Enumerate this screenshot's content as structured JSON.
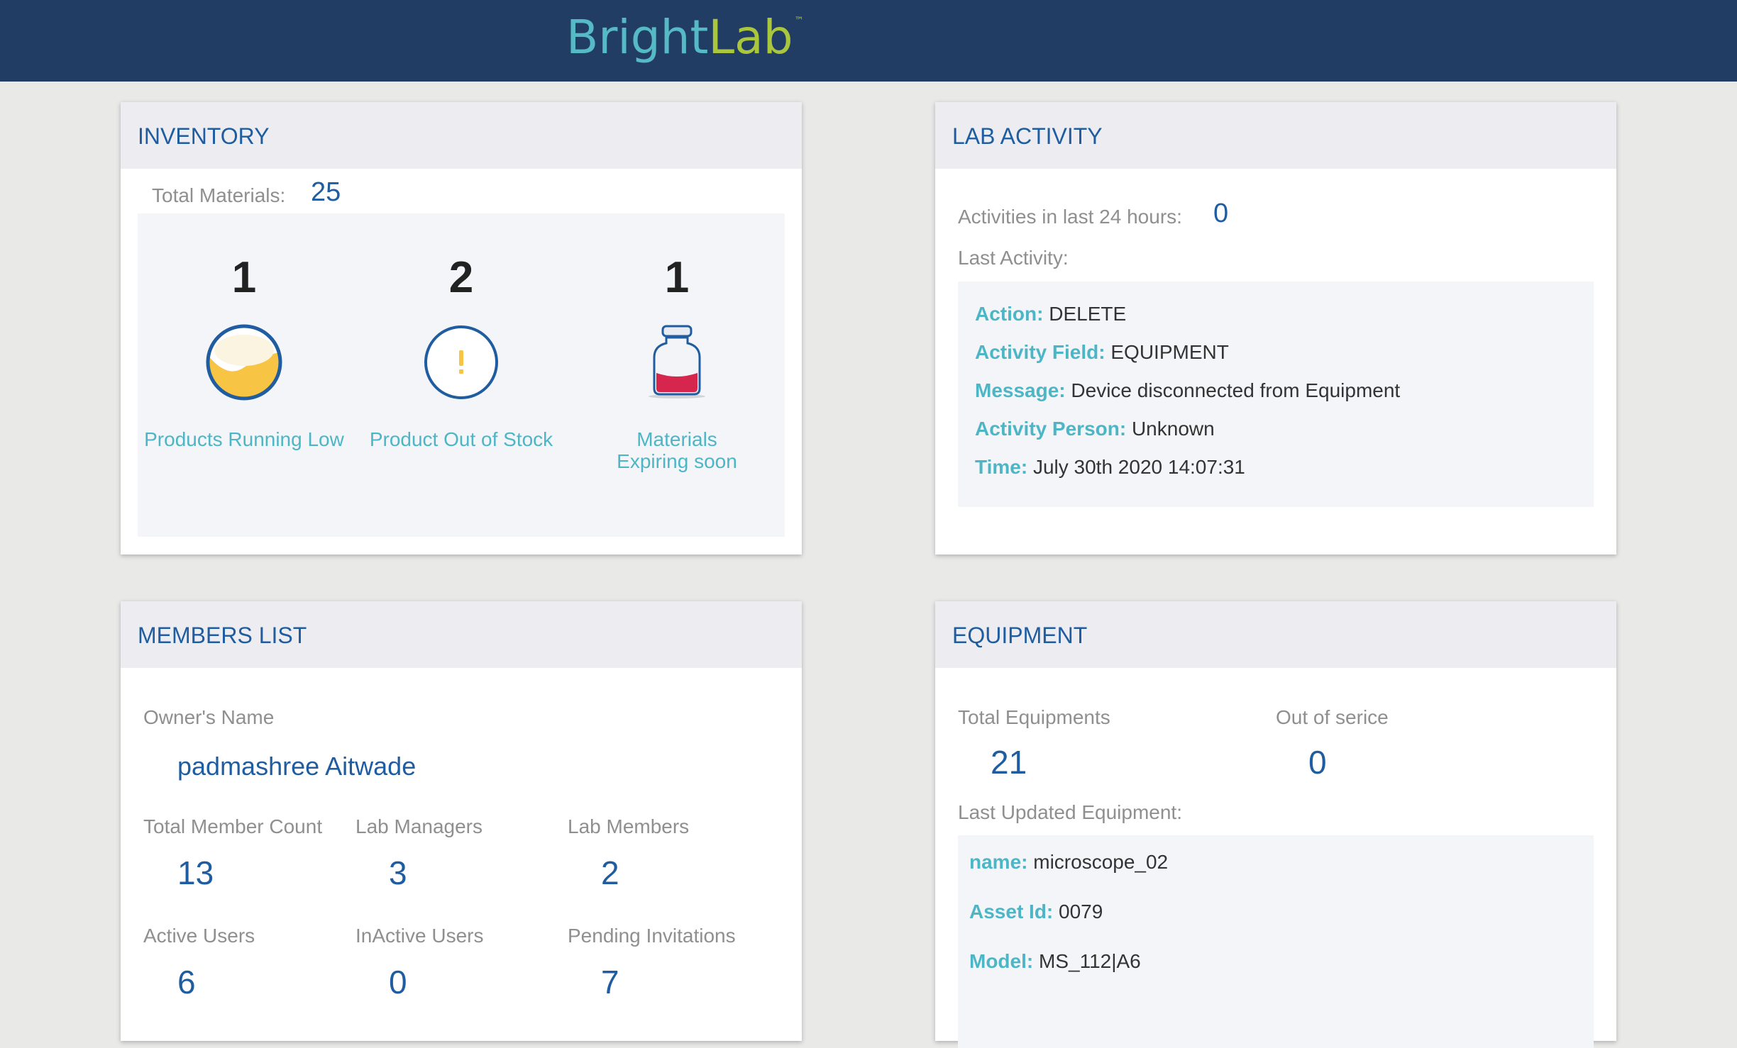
{
  "header": {
    "logo_part1": "Bright",
    "logo_part2": "Lab",
    "logo_tm": "™"
  },
  "colors": {
    "header_bg": "#213d63",
    "accent": "#1f5da0",
    "teal": "#4cb6c7",
    "logo_green": "#a9c63d"
  },
  "inventory": {
    "title": "INVENTORY",
    "total_label": "Total Materials:",
    "total_value": "25",
    "items": [
      {
        "count": "1",
        "label": "Products Running Low",
        "icon": "half-full-circle-icon"
      },
      {
        "count": "2",
        "label": "Product Out of Stock",
        "icon": "exclamation-circle-icon"
      },
      {
        "count": "1",
        "label": "Materials Expiring soon",
        "icon": "bottle-icon"
      }
    ]
  },
  "lab_activity": {
    "title": "LAB ACTIVITY",
    "activities_label": "Activities in last 24 hours:",
    "activities_value": "0",
    "last_activity_label": "Last Activity:",
    "details": [
      {
        "key": "Action:",
        "value": "DELETE"
      },
      {
        "key": "Activity Field:",
        "value": "EQUIPMENT"
      },
      {
        "key": "Message:",
        "value": "Device disconnected from Equipment"
      },
      {
        "key": "Activity Person:",
        "value": "Unknown"
      },
      {
        "key": "Time:",
        "value": "July 30th 2020 14:07:31"
      }
    ]
  },
  "members": {
    "title": "MEMBERS LIST",
    "owner_label": "Owner's Name",
    "owner_name": "padmashree Aitwade",
    "stats": [
      {
        "label": "Total Member Count",
        "value": "13"
      },
      {
        "label": "Lab Managers",
        "value": "3"
      },
      {
        "label": "Lab Members",
        "value": "2"
      },
      {
        "label": "Active Users",
        "value": "6"
      },
      {
        "label": "InActive Users",
        "value": "0"
      },
      {
        "label": "Pending Invitations",
        "value": "7"
      }
    ]
  },
  "equipment": {
    "title": "EQUIPMENT",
    "total_label": "Total Equipments",
    "total_value": "21",
    "out_label": "Out of serice",
    "out_value": "0",
    "last_updated_label": "Last Updated Equipment:",
    "details": [
      {
        "key": "name:",
        "value": "microscope_02"
      },
      {
        "key": "Asset Id:",
        "value": "0079"
      },
      {
        "key": "Model:",
        "value": "MS_112|A6"
      }
    ]
  }
}
